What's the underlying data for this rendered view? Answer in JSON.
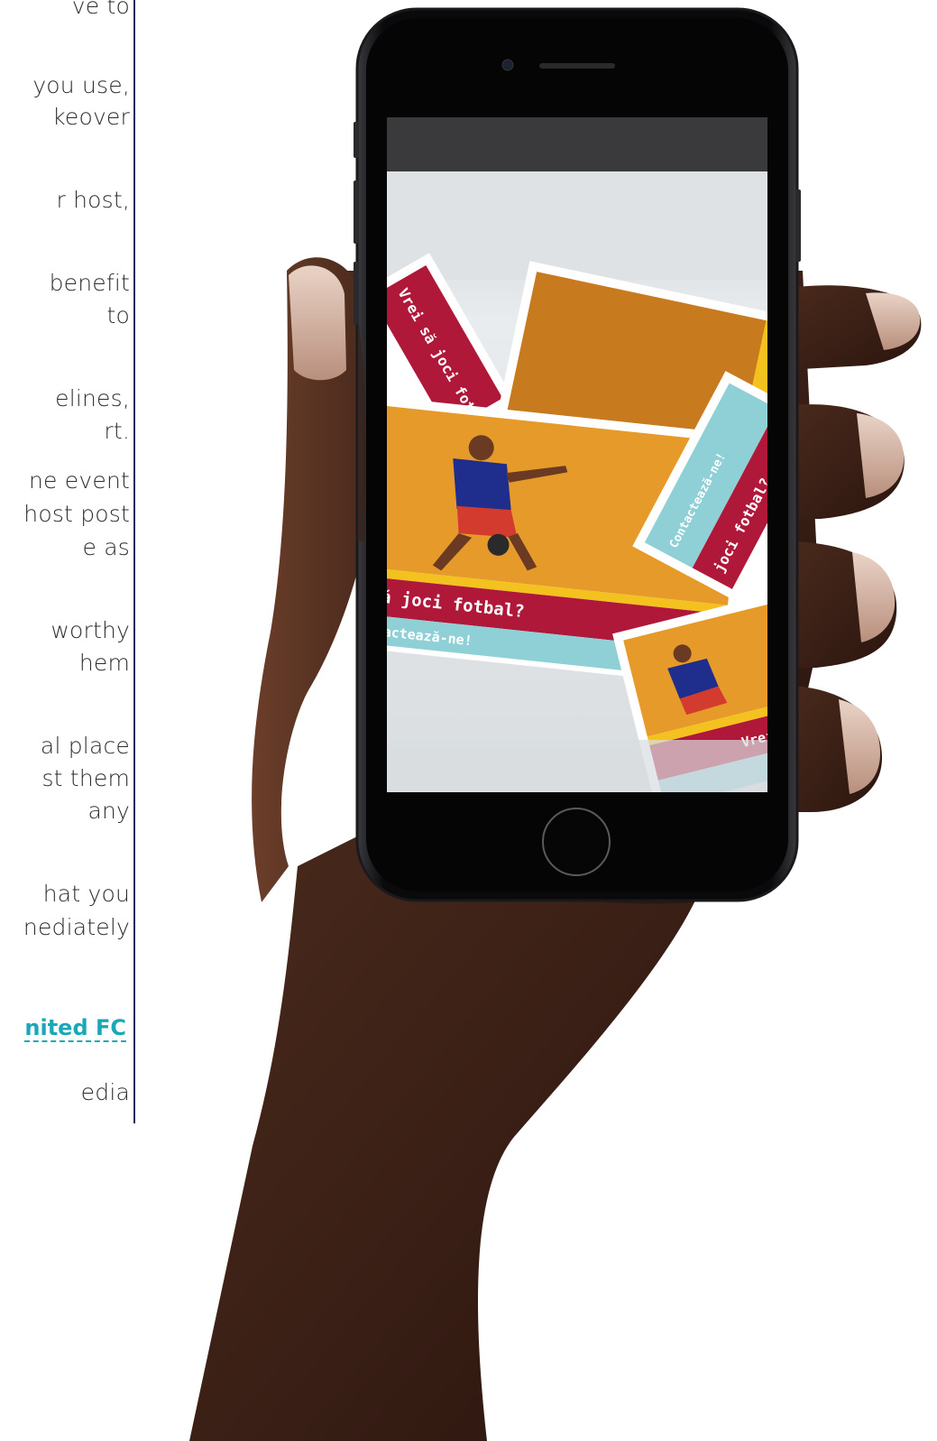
{
  "article": {
    "lines": [
      "ve to",
      "you use,",
      "keover",
      "r host,",
      "benefit",
      "to",
      "elines,",
      "rt.",
      "ne event",
      "host post",
      "e as",
      "worthy",
      "hem",
      "al place",
      "st them",
      "any",
      "hat you",
      "nediately",
      "edia"
    ],
    "link_text": "nited FC"
  },
  "phone_screen": {
    "card_headline": "să joci fotbal?",
    "card_cta": "ntactează-ne!",
    "card_side_headline": "joci fotbal?",
    "card_side_cta": "Contactează-ne!",
    "card_top_left": "Vrei să joci fotbal",
    "card_bottom_right": "Vrei să joci"
  },
  "colors": {
    "accent_link": "#1aa7b8",
    "divider": "#1a2a5a",
    "card_red": "#b0183a",
    "card_teal": "#8fd0d6",
    "card_orange": "#e59a2a",
    "card_yellow": "#f3c21f"
  }
}
